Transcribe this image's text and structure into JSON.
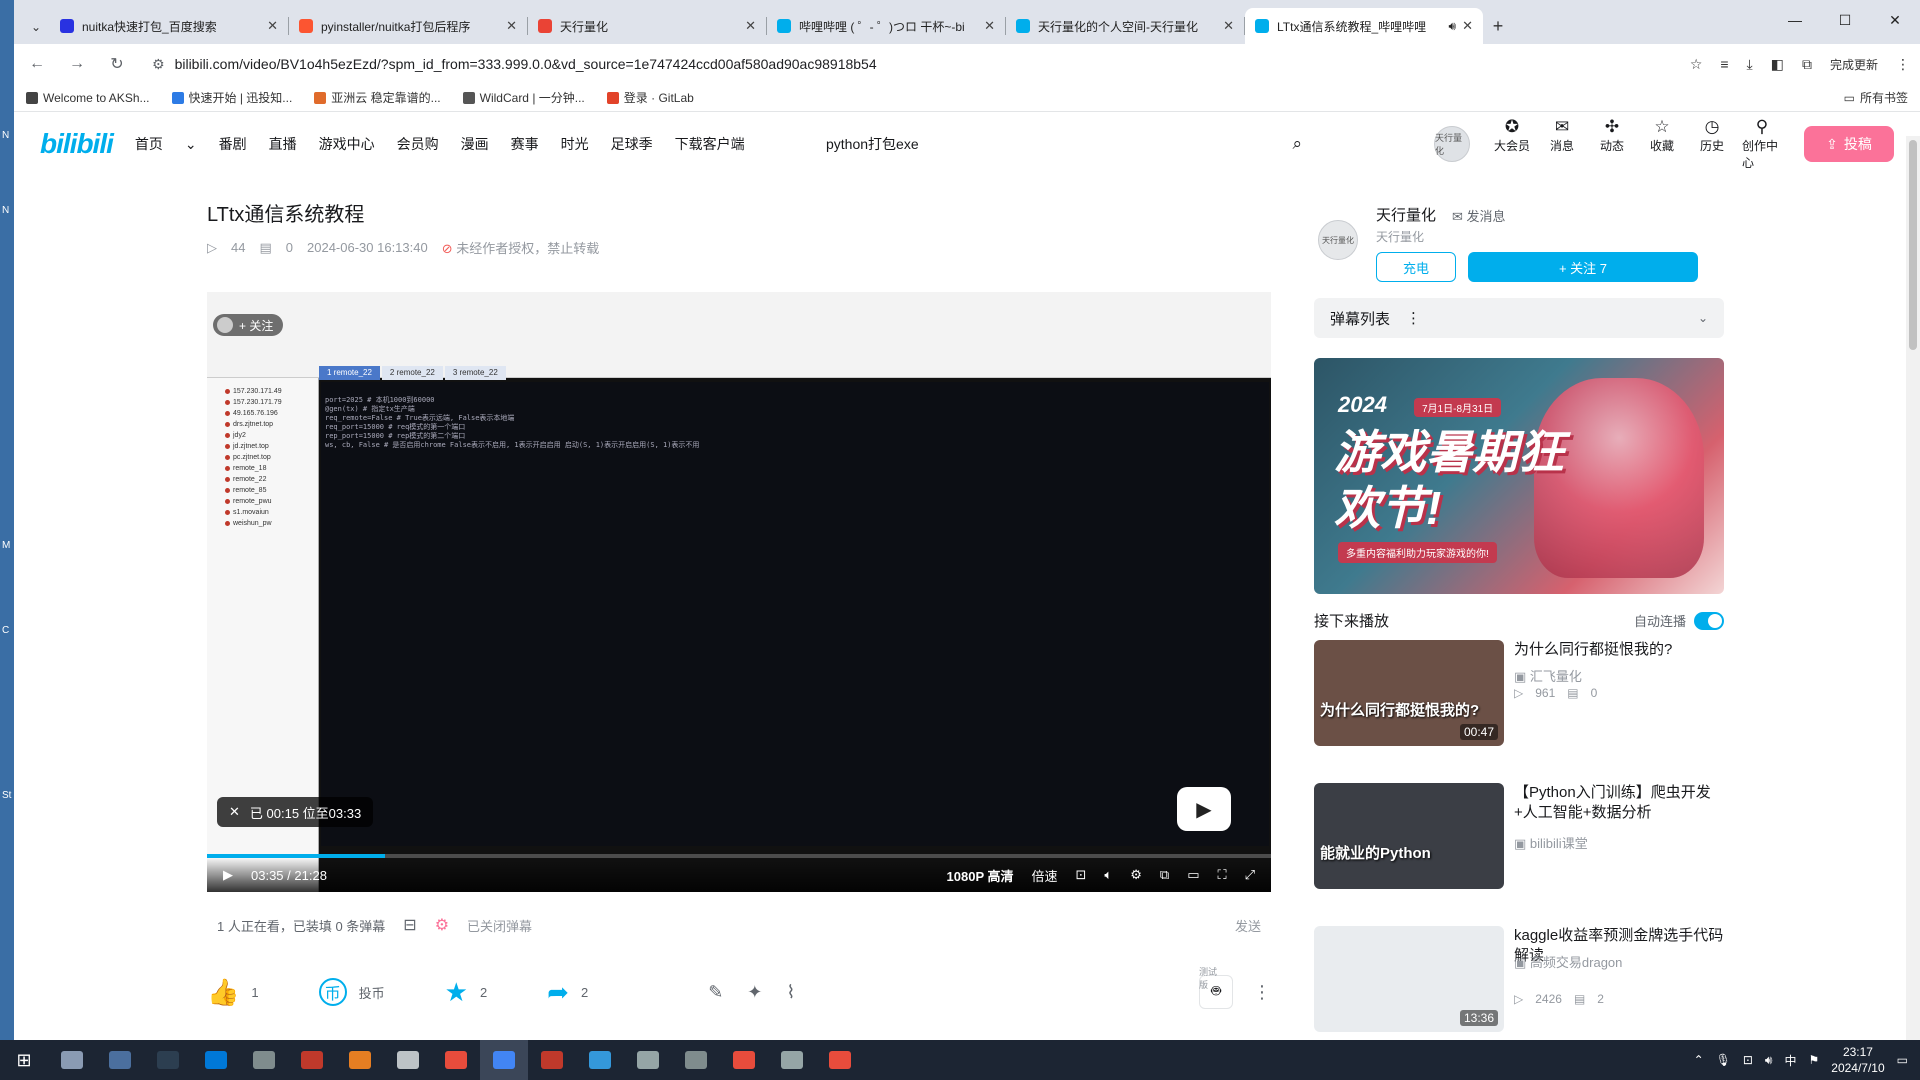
{
  "desktop": {
    "side_letters": [
      "N",
      "N",
      "M",
      "C",
      "St"
    ]
  },
  "browser": {
    "tabs": [
      {
        "title": "nuitka快速打包_百度搜索",
        "icon": "baidu-icon",
        "color": "#2932e1",
        "active": false
      },
      {
        "title": "pyinstaller/nuitka打包后程序",
        "icon": "csdn-icon",
        "color": "#fc5531",
        "active": false
      },
      {
        "title": "天行量化",
        "icon": "page-icon",
        "color": "#ea4335",
        "active": false
      },
      {
        "title": "哔哩哔哩 ( ゜- ゜)つロ 干杯~-bi",
        "icon": "bilibili-icon",
        "color": "#00aeec",
        "active": false
      },
      {
        "title": "天行量化的个人空间-天行量化",
        "icon": "bilibili-icon",
        "color": "#00aeec",
        "active": false
      },
      {
        "title": "LTtx通信系统教程_哔哩哔哩",
        "icon": "bilibili-icon",
        "color": "#00aeec",
        "active": true
      }
    ],
    "url": "bilibili.com/video/BV1o4h5ezEzd/?spm_id_from=333.999.0.0&vd_source=1e747424ccd00af580ad90ac98918b54",
    "profile_label": "完成更新",
    "bookmarks": [
      {
        "label": "Welcome to AKSh...",
        "color": "#444444"
      },
      {
        "label": "快速开始 | 迅投知...",
        "color": "#2d7be5"
      },
      {
        "label": "亚洲云 稳定靠谱的...",
        "color": "#e06b2b"
      },
      {
        "label": "WildCard | 一分钟...",
        "color": "#555555"
      },
      {
        "label": "登录 · GitLab",
        "color": "#e24329"
      }
    ],
    "bookmarks_right": "所有书签"
  },
  "header": {
    "logo": "bilibili",
    "nav": [
      "首页",
      "番剧",
      "直播",
      "游戏中心",
      "会员购",
      "漫画",
      "赛事",
      "时光",
      "足球季",
      "下载客户端"
    ],
    "search_value": "python打包exe",
    "avatar_text": "天行量化",
    "right_items": [
      {
        "label": "大会员",
        "icon": "vip-icon",
        "glyph": "✪"
      },
      {
        "label": "消息",
        "icon": "message-icon",
        "glyph": "✉"
      },
      {
        "label": "动态",
        "icon": "dynamic-icon",
        "glyph": "✣"
      },
      {
        "label": "收藏",
        "icon": "favorite-icon",
        "glyph": "☆"
      },
      {
        "label": "历史",
        "icon": "history-icon",
        "glyph": "◷"
      },
      {
        "label": "创作中心",
        "icon": "creator-icon",
        "glyph": "⚲"
      }
    ],
    "upload_label": "投稿"
  },
  "video": {
    "title": "LTtx通信系统教程",
    "views": "44",
    "danmaku_count": "0",
    "date": "2024-06-30 16:13:40",
    "copyright": "未经作者授权，禁止转载",
    "follow_chip": "+ 关注",
    "toast": "已 00:15 位至03:33",
    "time_current": "03:35",
    "time_total": "21:28",
    "progress": 0.167,
    "quality": "1080P 高清",
    "speed": "倍速",
    "terminal": {
      "tabs": [
        "1 remote_22",
        "2 remote_22",
        "3 remote_22"
      ],
      "lines": [
        "port=2025     # 本机1000到60000",
        "@gen(tx)      # 指定tx生产端",
        "req_remote=False   # True表示远端, False表示本地端",
        "req_port=15000     # req模式的第一个端口",
        "rep_port=15000     # rep模式的第二个端口",
        "ws, cb, False  # 是否启用chrome  False表示不启用, 1表示开启启用   启动(S, 1)表示开启启用(S, 1)表示不用"
      ],
      "sessions": [
        "157.230.171.49",
        "157.230.171.79",
        "49.165.76.196",
        "drs.zjtnet.top",
        "jdy2",
        "jd.zjtnet.top",
        "pc.zjtnet.top",
        "remote_18",
        "remote_22",
        "remote_85",
        "remote_pwu",
        "s1.movaiun",
        "weishun_pw"
      ]
    },
    "viewers_text": "1 人正在看，已装填 0 条弹幕",
    "danmaku_off": "已关闭弹幕",
    "send_label": "发送",
    "actions": [
      {
        "label": "1",
        "icon": "like-icon",
        "glyph": "👍"
      },
      {
        "label": "投币",
        "icon": "coin-icon",
        "glyph": "币"
      },
      {
        "label": "2",
        "icon": "collect-icon",
        "glyph": "★"
      },
      {
        "label": "2",
        "icon": "share-icon",
        "glyph": "➦"
      }
    ],
    "mascot_label": "测试版"
  },
  "uploader": {
    "name": "天行量化",
    "message_label": "发消息",
    "sign": "天行量化",
    "charge_label": "充电",
    "follow_label": "+ 关注 7"
  },
  "danmaku_panel": {
    "title": "弹幕列表"
  },
  "ad": {
    "year": "2024",
    "date": "7月1日-8月31日",
    "title": "游戏暑期狂欢节!",
    "subtitle": "多重内容福利助力玩家游戏的你!"
  },
  "up_next": {
    "title": "接下来播放",
    "autoplay_label": "自动连播",
    "items": [
      {
        "title": "为什么同行都挺恨我的?",
        "author": "汇飞量化",
        "views": "961",
        "danmaku": "0",
        "duration": "00:47",
        "thumb_text": "为什么同行都挺恨我的?",
        "thumb_color": "#6b5046"
      },
      {
        "title": "【Python入门训练】爬虫开发+人工智能+数据分析",
        "author": "bilibili课堂",
        "views": "",
        "danmaku": "",
        "duration": "",
        "thumb_text": "能就业的Python",
        "thumb_color": "#3b3e45"
      },
      {
        "title": "kaggle收益率预测金牌选手代码解读",
        "author": "高频交易dragon",
        "views": "2426",
        "danmaku": "2",
        "duration": "13:36",
        "thumb_text": "",
        "thumb_color": "#e9ecef"
      }
    ]
  },
  "taskbar": {
    "apps": [
      "#8a9bb3",
      "#4b6f9e",
      "#2c3e50",
      "#0078d7",
      "#7f8c8d",
      "#c0392b",
      "#e67e22",
      "#bdc3c7",
      "#e74c3c",
      "#4285f4",
      "#c0392b",
      "#3498db",
      "#95a5a6",
      "#7f8c8d",
      "#e74c3c",
      "#95a5a6",
      "#e74c3c"
    ],
    "ime": "中",
    "time": "23:17",
    "date": "2024/7/10"
  }
}
